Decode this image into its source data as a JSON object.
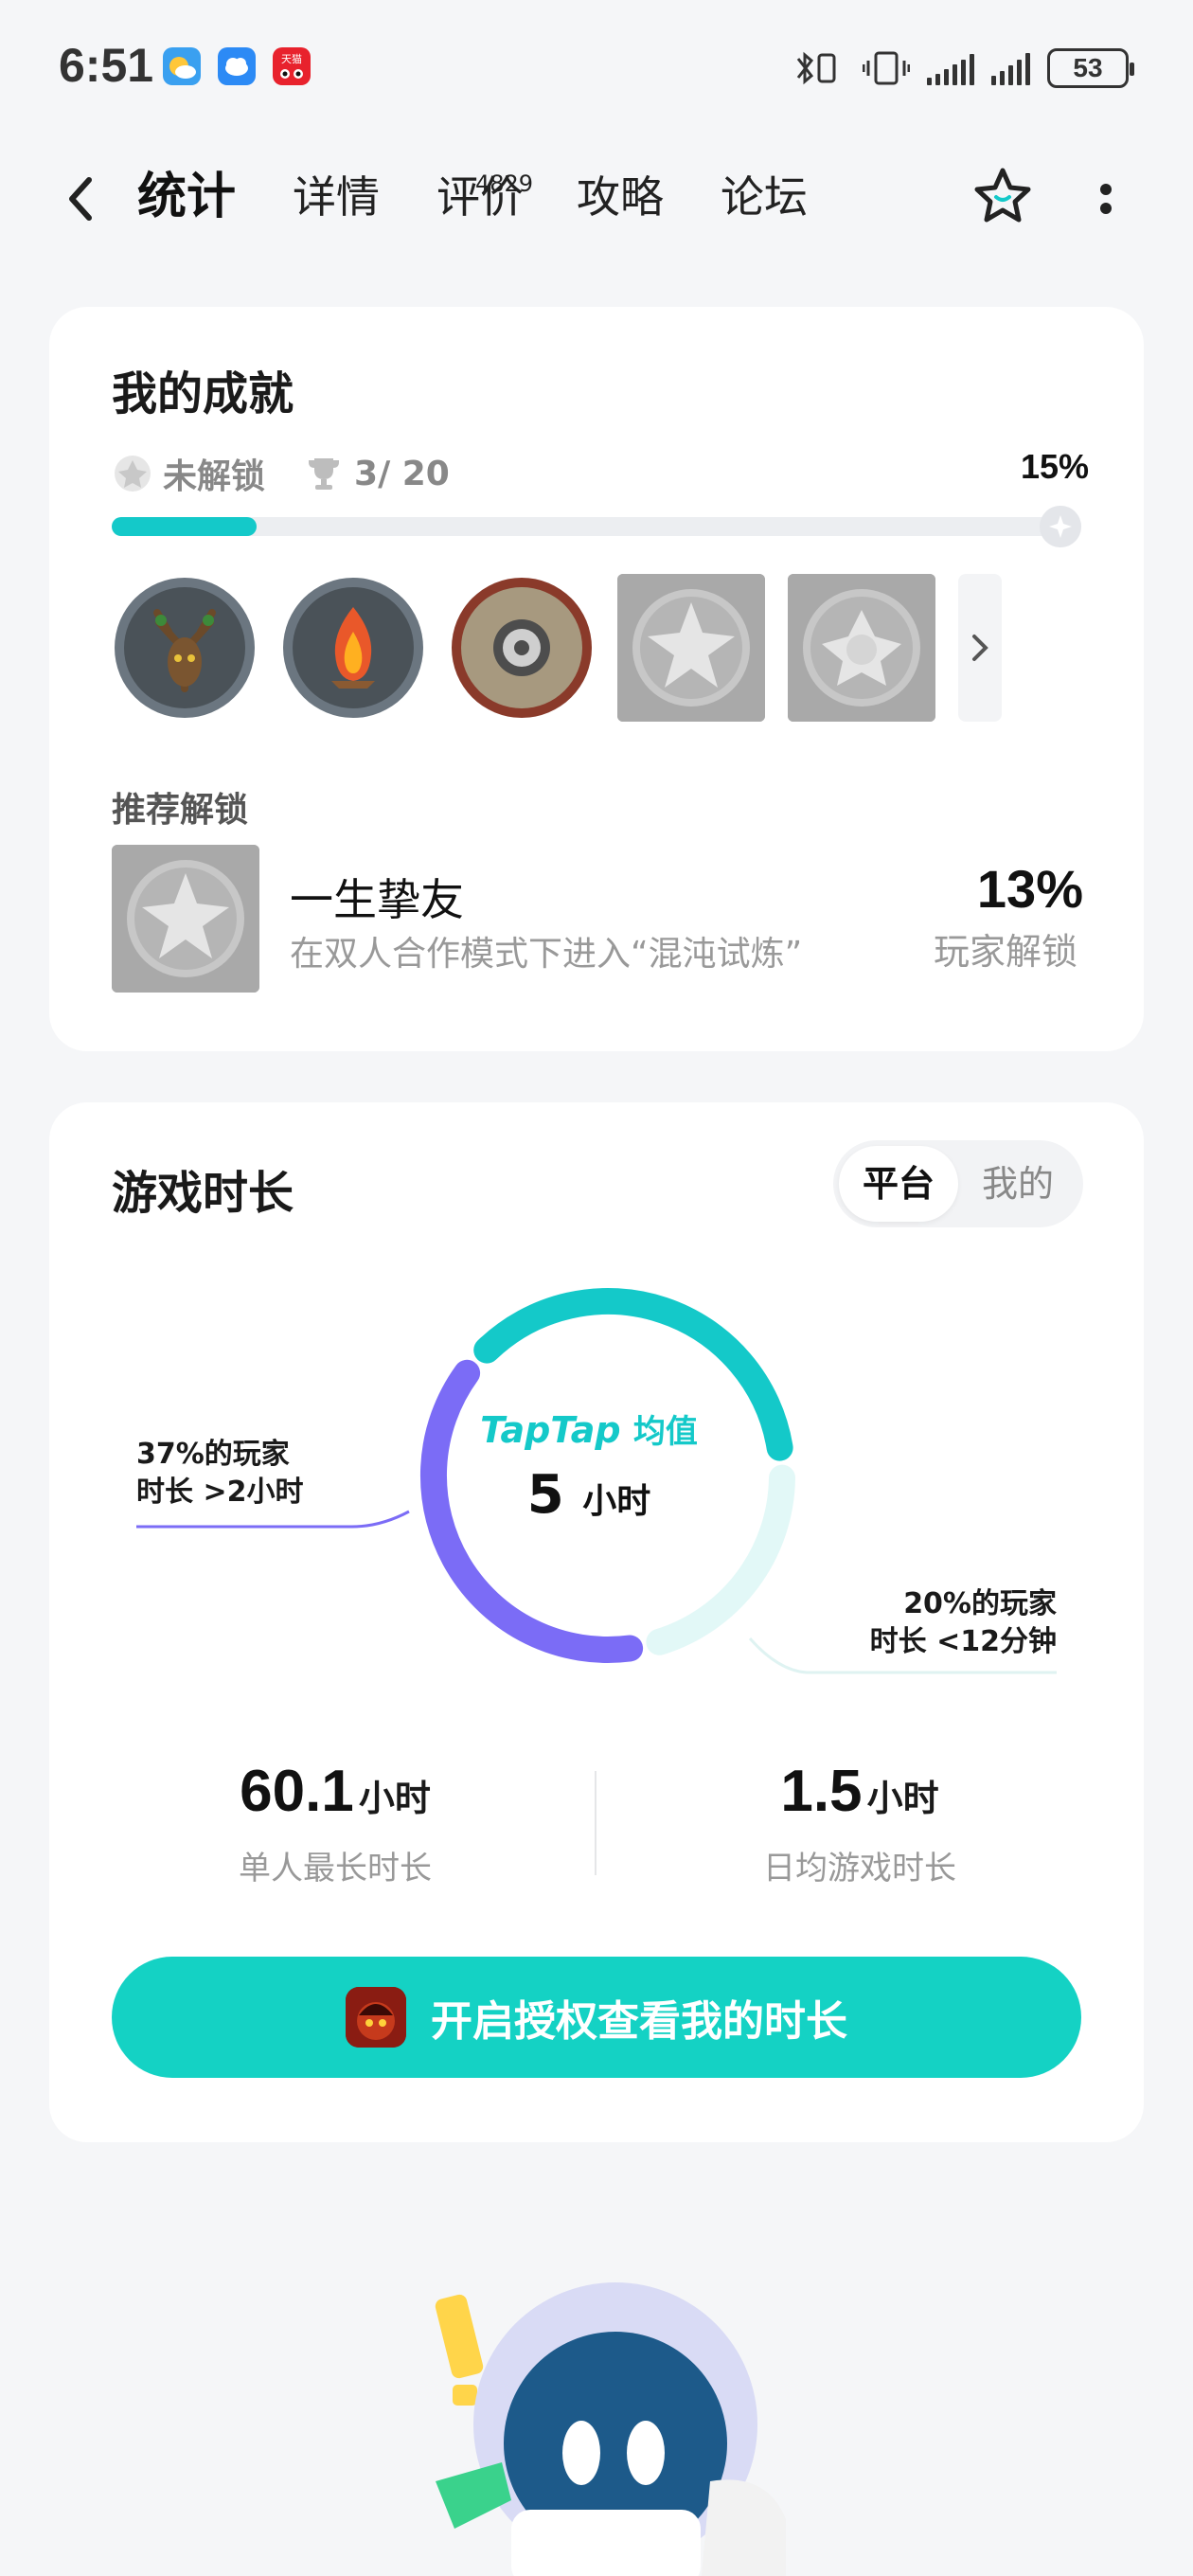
{
  "status_bar": {
    "time": "6:51",
    "app_icons": [
      "weather-sun-icon",
      "cloud-icon",
      "tmall-icon"
    ],
    "battery": "53",
    "tmall_label": "天猫"
  },
  "nav": {
    "tabs": [
      {
        "label": "统计",
        "active": true
      },
      {
        "label": "详情",
        "active": false
      },
      {
        "label": "评价",
        "active": false,
        "badge": "4829"
      },
      {
        "label": "攻略",
        "active": false
      },
      {
        "label": "论坛",
        "active": false
      }
    ],
    "accent": "#14c9c9"
  },
  "achievements": {
    "title": "我的成就",
    "locked_label": "未解锁",
    "trophy_count": "3/ 20",
    "percent": "15%",
    "progress": 0.15,
    "badges": [
      {
        "icon": "tree-spirit-badge-icon",
        "unlocked": true
      },
      {
        "icon": "fire-badge-icon",
        "unlocked": true
      },
      {
        "icon": "gear-shield-badge-icon",
        "unlocked": true
      },
      {
        "icon": "star-burst-badge-icon",
        "unlocked": false
      },
      {
        "icon": "crystal-flower-badge-icon",
        "unlocked": false
      }
    ],
    "recommend": {
      "label": "推荐解锁",
      "name": "一生挚友",
      "desc": "在双人合作模式下进入“混沌试炼”",
      "percent": "13%",
      "percent_label": "玩家解锁"
    }
  },
  "playtime": {
    "title": "游戏时长",
    "toggle": {
      "platform": "平台",
      "mine": "我的"
    },
    "brand": "TapTap",
    "brand_sub": "均值",
    "center_value": "5",
    "center_unit": "小时",
    "left_note": {
      "line1": "37%的玩家",
      "line2": "时长 >2小时"
    },
    "right_note": {
      "line1": "20%的玩家",
      "line2": "时长 <12分钟"
    },
    "segments": {
      "over_2h": 0.37,
      "under_12min": 0.2
    },
    "colors": {
      "purple": "#7b6cf6",
      "teal": "#14c9c9",
      "light_teal": "#e2f8f7"
    },
    "stats": [
      {
        "value": "60.1",
        "unit": "小时",
        "label": "单人最长时长"
      },
      {
        "value": "1.5",
        "unit": "小时",
        "label": "日均游戏时长"
      }
    ],
    "cta": "开启授权查看我的时长"
  }
}
